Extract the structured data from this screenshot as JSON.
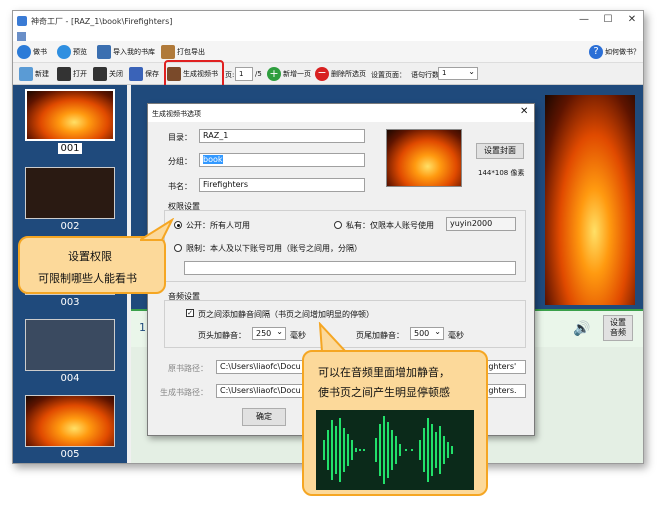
{
  "window": {
    "title": "神奇工厂 - [RAZ_1\\book\\Firefighters]"
  },
  "toolbar1": {
    "make_book": "做书",
    "preview": "预览",
    "import": "导入我的书库",
    "export": "打包导出",
    "how_to": "如何做书？"
  },
  "toolbar2": {
    "new": "新建",
    "open": "打开",
    "close": "关闭",
    "save": "保存",
    "gen_video": "生成视频书",
    "page_label": "页:",
    "page_value": "1",
    "page_total": "/5",
    "add_page": "新增一页",
    "delete_page": "删除所选页",
    "settings_label": "设置页面：",
    "rows_label": "语句行数",
    "rows_value": "1"
  },
  "thumbnails": [
    {
      "label": "001"
    },
    {
      "label": "002"
    },
    {
      "label": "003"
    },
    {
      "label": "004"
    },
    {
      "label": "005"
    }
  ],
  "page_area": {
    "row_number": "1",
    "audio_settings": "设置\n音频"
  },
  "dialog": {
    "title": "生成视频书选项",
    "directory_label": "目录：",
    "directory_value": "RAZ_1",
    "group_label": "分组：",
    "group_value": "book",
    "name_label": "书名：",
    "name_value": "Firefighters",
    "cover_button": "设置封面",
    "cover_size": "144*108 像素",
    "perm_section": "权限设置",
    "public": "公开：所有人可用",
    "private": "私有：仅限本人账号使用",
    "account": "yuyin2000",
    "restricted": "限制：本人及以下账号可用（账号之间用，分隔）",
    "audio_section": "音频设置",
    "silence_check": "页之间添加静音间隔（书页之间增加明显的停顿）",
    "head_label": "页头加静音：",
    "head_value": "250",
    "tail_label": "页尾加静音：",
    "tail_value": "500",
    "ms": "毫秒",
    "source_label": "原书路径：",
    "source_value": "C:\\Users\\liaofc\\Docu",
    "source_tail": "Firefighters'",
    "output_label": "生成书路径：",
    "output_value": "C:\\Users\\liaofc\\Docu",
    "output_tail": "Firefighters.",
    "ok": "确定"
  },
  "callouts": {
    "perm_line1": "设置权限",
    "perm_line2": "可限制哪些人能看书",
    "audio_line1": "可以在音频里面增加静音，",
    "audio_line2": "使书页之间产生明显停顿感"
  },
  "colors": {
    "accent_red": "#e02020",
    "callout_fill": "#fcd99a",
    "callout_border": "#f5a623",
    "panel_blue": "#1f4a7c"
  }
}
